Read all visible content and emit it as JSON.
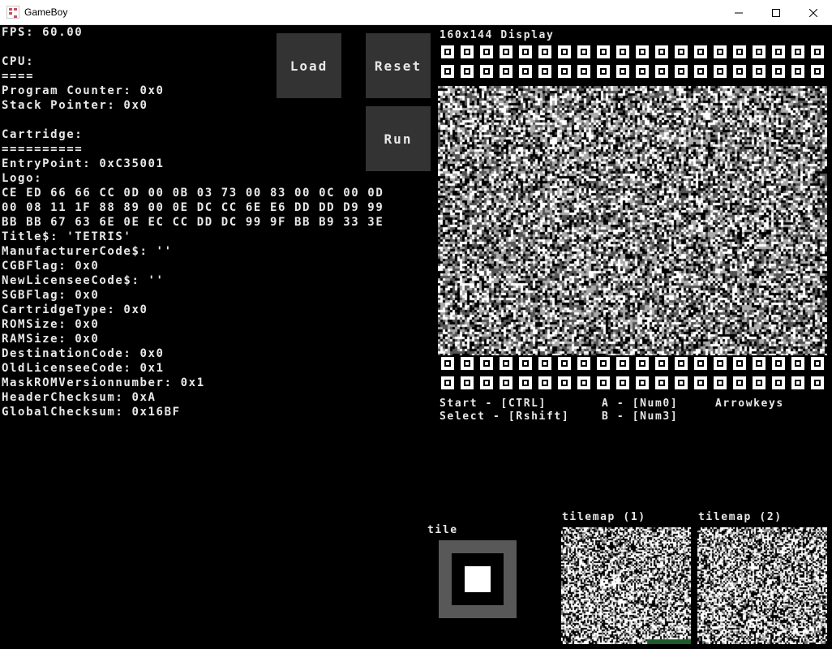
{
  "window": {
    "title": "GameBoy"
  },
  "info": {
    "lines": [
      "FPS: 60.00",
      "",
      "CPU:",
      "====",
      "Program Counter: 0x0",
      "Stack Pointer: 0x0",
      "",
      "Cartridge:",
      "==========",
      "EntryPoint: 0xC35001",
      "Logo:",
      "CE ED 66 66 CC 0D 00 0B 03 73 00 83 00 0C 00 0D",
      "00 08 11 1F 88 89 00 0E DC CC 6E E6 DD DD D9 99",
      "BB BB 67 63 6E 0E EC CC DD DC 99 9F BB B9 33 3E",
      "Title$: 'TETRIS'",
      "ManufacturerCode$: ''",
      "CGBFlag: 0x0",
      "NewLicenseeCode$: ''",
      "SGBFlag: 0x0",
      "CartridgeType: 0x0",
      "ROMSize: 0x0",
      "RAMSize: 0x0",
      "DestinationCode: 0x0",
      "OldLicenseeCode: 0x1",
      "MaskROMVersionnumber: 0x1",
      "HeaderChecksum: 0xA",
      "GlobalChecksum: 0x16BF"
    ]
  },
  "buttons": {
    "load": "Load",
    "reset": "Reset",
    "run": "Run"
  },
  "display": {
    "label": "160x144 Display"
  },
  "controls": {
    "start": "Start - [CTRL]",
    "select": "Select - [Rshift]",
    "a": "A - [Num0]",
    "b": "B - [Num3]",
    "arrows": "Arrowkeys"
  },
  "tile": {
    "label": "tile"
  },
  "tilemaps": {
    "label1": "tilemap (1)",
    "label2": "tilemap (2)"
  },
  "colors": {
    "background": "#000000",
    "button": "#333333",
    "text": "#e8e8e8",
    "tile_border": "#585858"
  },
  "icons": {
    "app": "gameboy-app-icon",
    "minimize": "minimize-icon",
    "maximize": "maximize-icon",
    "close": "close-icon"
  }
}
